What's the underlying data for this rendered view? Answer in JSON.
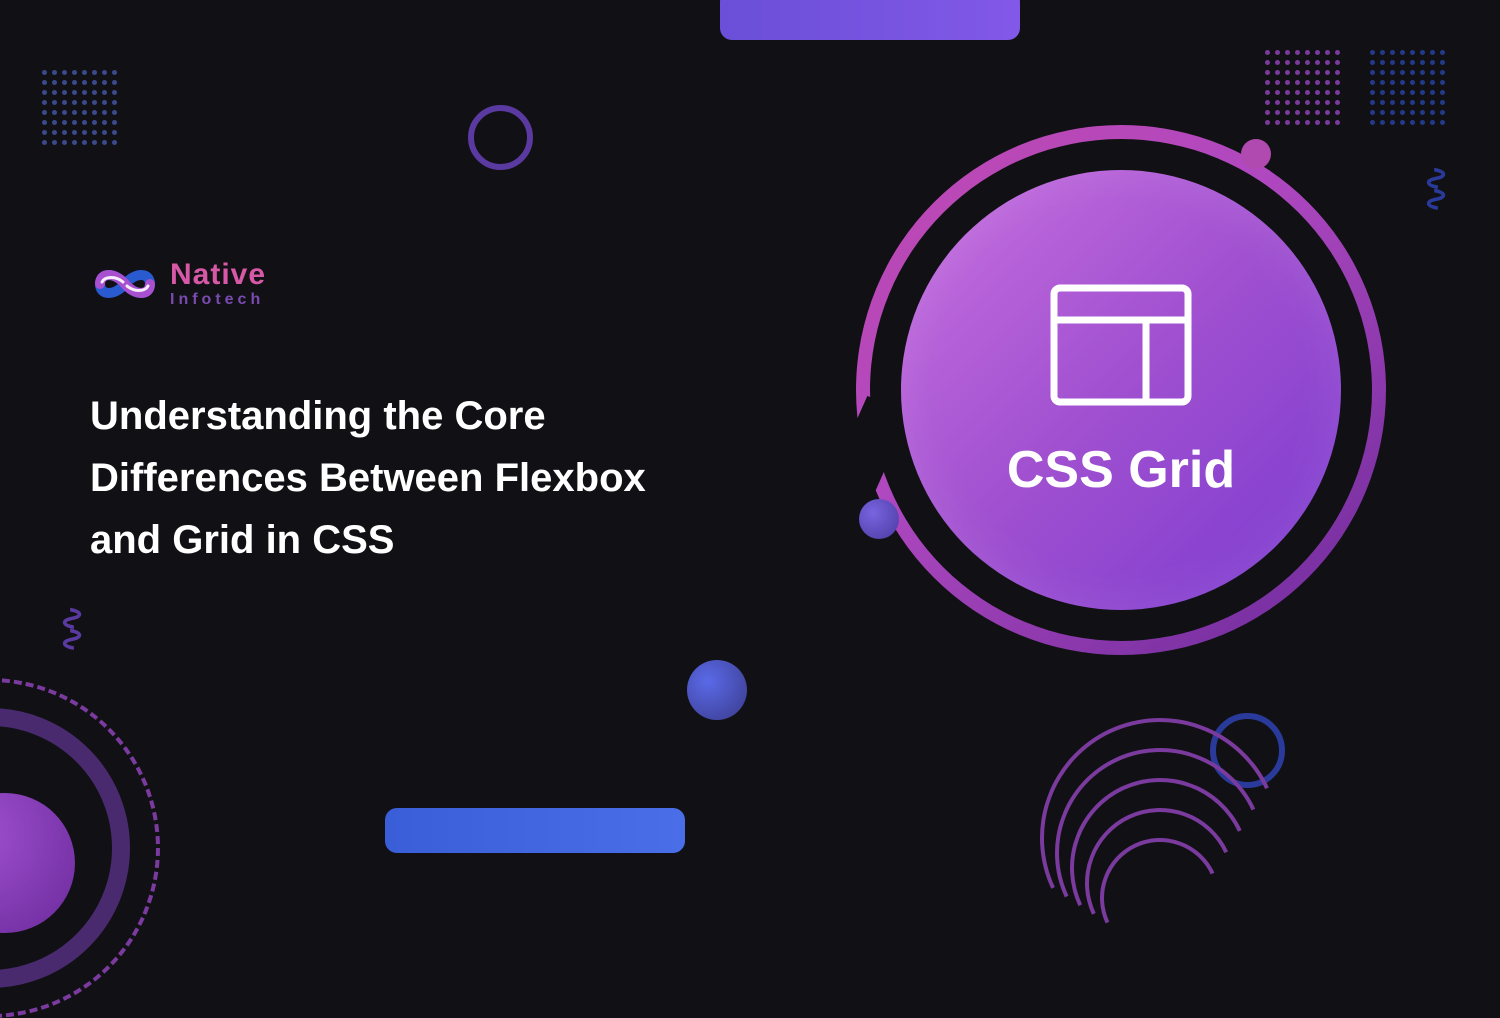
{
  "logo": {
    "title": "Native",
    "subtitle": "Infotech"
  },
  "heading": "Understanding the Core Differences Between Flexbox and Grid in CSS",
  "feature": {
    "label": "CSS Grid",
    "icon": "grid-layout-icon"
  },
  "colors": {
    "background": "#111115",
    "accent_purple": "#a050d0",
    "accent_blue": "#3a5ed8",
    "accent_pink": "#c870e0",
    "text": "#ffffff"
  }
}
